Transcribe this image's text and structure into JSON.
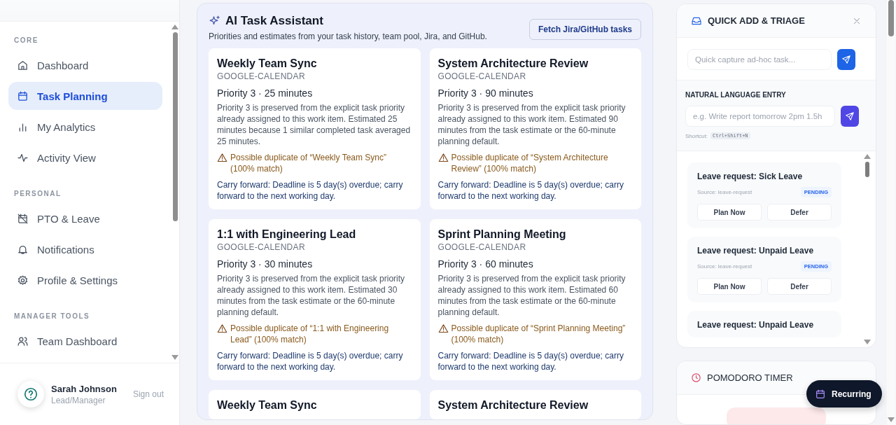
{
  "sidebar": {
    "sections": [
      {
        "label": "CORE",
        "items": [
          {
            "label": "Dashboard",
            "selected": false
          },
          {
            "label": "Task Planning",
            "selected": true
          },
          {
            "label": "My Analytics",
            "selected": false
          },
          {
            "label": "Activity View",
            "selected": false
          }
        ]
      },
      {
        "label": "PERSONAL",
        "items": [
          {
            "label": "PTO & Leave",
            "selected": false
          },
          {
            "label": "Notifications",
            "selected": false
          },
          {
            "label": "Profile & Settings",
            "selected": false
          }
        ]
      },
      {
        "label": "MANAGER TOOLS",
        "items": [
          {
            "label": "Team Dashboard",
            "selected": false
          }
        ]
      }
    ],
    "user": {
      "name": "Sarah Johnson",
      "role": "Lead/Manager"
    },
    "sign_out": "Sign out"
  },
  "ai_panel": {
    "title": "AI Task Assistant",
    "subtitle": "Priorities and estimates from your task history, team pool, Jira, and GitHub.",
    "fetch_button": "Fetch Jira/GitHub tasks",
    "tasks": [
      {
        "title": "Weekly Team Sync",
        "source": "GOOGLE-CALENDAR",
        "meta": "Priority 3 · 25 minutes",
        "explanation": "Priority 3 is preserved from the explicit task priority already assigned to this work item. Estimated 25 minutes because 1 similar completed task averaged 25 minutes.",
        "warning": "Possible duplicate of “Weekly Team Sync” (100% match)",
        "carry_forward": "Carry forward: Deadline is 5 day(s) overdue; carry forward to the next working day."
      },
      {
        "title": "System Architecture Review",
        "source": "GOOGLE-CALENDAR",
        "meta": "Priority 3 · 90 minutes",
        "explanation": "Priority 3 is preserved from the explicit task priority already assigned to this work item. Estimated 90 minutes from the task estimate or the 60-minute planning default.",
        "warning": "Possible duplicate of “System Architecture Review” (100% match)",
        "carry_forward": "Carry forward: Deadline is 5 day(s) overdue; carry forward to the next working day."
      },
      {
        "title": "1:1 with Engineering Lead",
        "source": "GOOGLE-CALENDAR",
        "meta": "Priority 3 · 30 minutes",
        "explanation": "Priority 3 is preserved from the explicit task priority already assigned to this work item. Estimated 30 minutes from the task estimate or the 60-minute planning default.",
        "warning": "Possible duplicate of “1:1 with Engineering Lead” (100% match)",
        "carry_forward": "Carry forward: Deadline is 5 day(s) overdue; carry forward to the next working day."
      },
      {
        "title": "Sprint Planning Meeting",
        "source": "GOOGLE-CALENDAR",
        "meta": "Priority 3 · 60 minutes",
        "explanation": "Priority 3 is preserved from the explicit task priority already assigned to this work item. Estimated 60 minutes from the task estimate or the 60-minute planning default.",
        "warning": "Possible duplicate of “Sprint Planning Meeting” (100% match)",
        "carry_forward": "Carry forward: Deadline is 5 day(s) overdue; carry forward to the next working day."
      },
      {
        "title": "Weekly Team Sync"
      },
      {
        "title": "System Architecture Review"
      }
    ]
  },
  "quick_add": {
    "title": "QUICK ADD & TRIAGE",
    "capture": {
      "placeholder": "Quick capture ad-hoc task..."
    },
    "nl_label": "NATURAL LANGUAGE ENTRY",
    "nl_entry": {
      "placeholder": "e.g. Write report tomorrow 2pm 1.5h"
    },
    "shortcut_label": "Shortcut:",
    "shortcut_key": "Ctrl+Shift+N",
    "requests": [
      {
        "title": "Leave request: Sick Leave",
        "source": "Source: leave-request",
        "status": "PENDING",
        "actions": [
          "Plan Now",
          "Defer"
        ]
      },
      {
        "title": "Leave request: Unpaid Leave",
        "source": "Source: leave-request",
        "status": "PENDING",
        "actions": [
          "Plan Now",
          "Defer"
        ]
      },
      {
        "title": "Leave request: Unpaid Leave"
      }
    ]
  },
  "pomodoro": {
    "title": "POMODORO TIMER"
  },
  "recurring_button": "Recurring"
}
